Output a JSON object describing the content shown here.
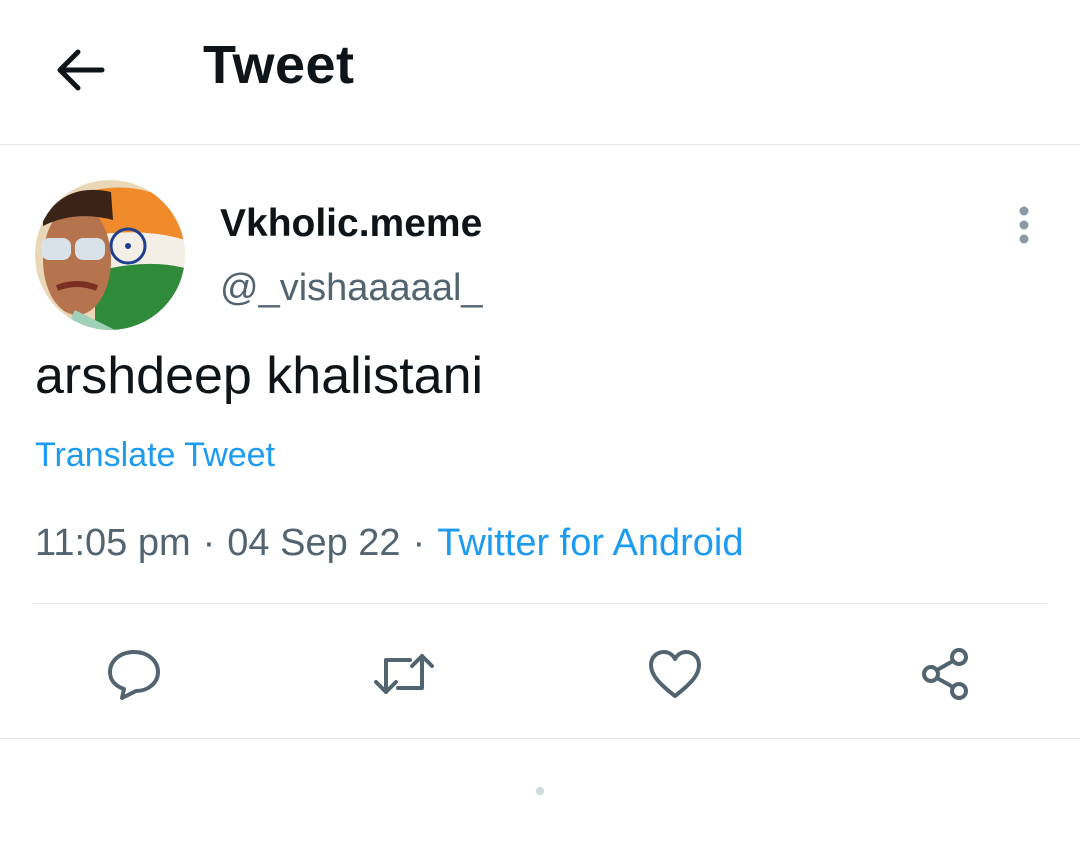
{
  "header": {
    "title": "Tweet",
    "back_icon": "arrow-left-icon"
  },
  "tweet": {
    "display_name": "Vkholic.meme",
    "username": "@_vishaaaaal_",
    "text": "arshdeep khalistani",
    "translate_label": "Translate Tweet",
    "time": "11:05 pm",
    "date": "04 Sep 22",
    "separator": "·",
    "source": "Twitter for Android"
  },
  "actions": [
    {
      "name": "reply",
      "icon": "reply-icon"
    },
    {
      "name": "retweet",
      "icon": "retweet-icon"
    },
    {
      "name": "like",
      "icon": "heart-icon"
    },
    {
      "name": "share",
      "icon": "share-icon"
    }
  ],
  "colors": {
    "accent": "#1d9bf0",
    "text_primary": "#0f1419",
    "text_secondary": "#536471",
    "divider": "#e3e6e8"
  }
}
